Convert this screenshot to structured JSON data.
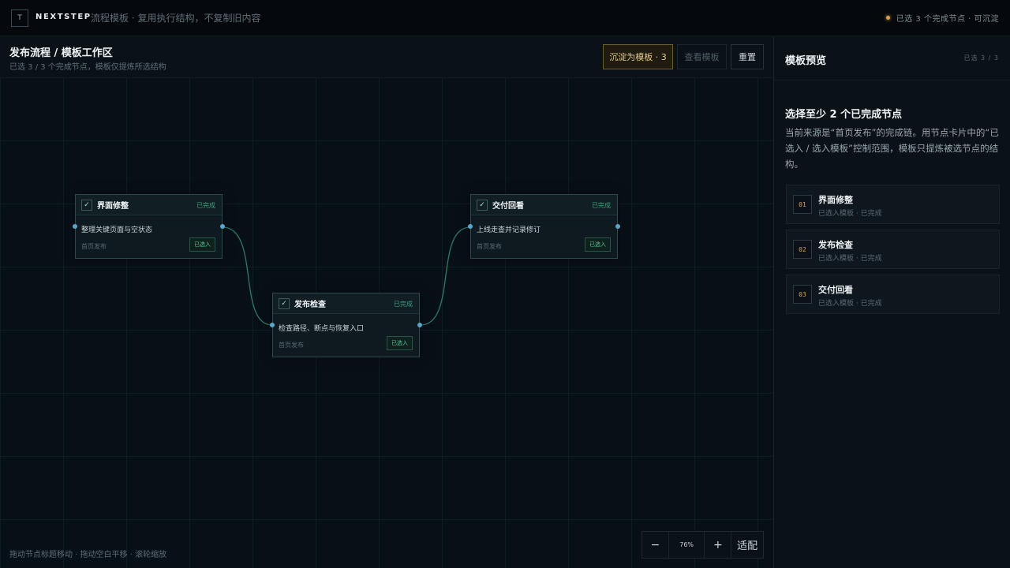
{
  "topbar": {
    "logo_letter": "T",
    "brand": "NEXTSTEP",
    "subtitle": "流程模板 · 复用执行结构，不复制旧内容",
    "status": "已选 3 个完成节点 · 可沉淀"
  },
  "canvas": {
    "title": "发布流程 / 模板工作区",
    "subtitle": "已选 3 / 3 个完成节点，模板仅提炼所选结构",
    "buttons": {
      "save_template": "沉淀为模板 · 3",
      "view_template": "查看模板",
      "reset": "重置"
    },
    "nodes": [
      {
        "title": "界面修整",
        "state": "已完成",
        "desc": "整理关键页面与空状态",
        "source": "首页发布",
        "badge": "已选入"
      },
      {
        "title": "发布检查",
        "state": "已完成",
        "desc": "检查路径、断点与恢复入口",
        "source": "首页发布",
        "badge": "已选入"
      },
      {
        "title": "交付回看",
        "state": "已完成",
        "desc": "上线走查并记录修订",
        "source": "首页发布",
        "badge": "已选入"
      }
    ],
    "hint": "拖动节点标题移动 · 拖动空白平移 · 滚轮缩放",
    "zoom": {
      "minus": "−",
      "level": "76%",
      "plus": "+",
      "fit": "适配"
    }
  },
  "panel": {
    "title": "模板预览",
    "count": "已选 3 / 3",
    "heading": "选择至少 2 个已完成节点",
    "text": "当前来源是“首页发布”的完成链。用节点卡片中的“已选入 / 选入模板”控制范围，模板只提炼被选节点的结构。",
    "items": [
      {
        "num": "01",
        "name": "界面修整",
        "sub": "已选入模板 · 已完成"
      },
      {
        "num": "02",
        "name": "发布检查",
        "sub": "已选入模板 · 已完成"
      },
      {
        "num": "03",
        "name": "交付回看",
        "sub": "已选入模板 · 已完成"
      }
    ]
  },
  "colors": {
    "accent_gold": "#d9a24a",
    "success_green": "#3e9c7a",
    "edge": "#2e7a62",
    "port": "#5aa6c8"
  }
}
